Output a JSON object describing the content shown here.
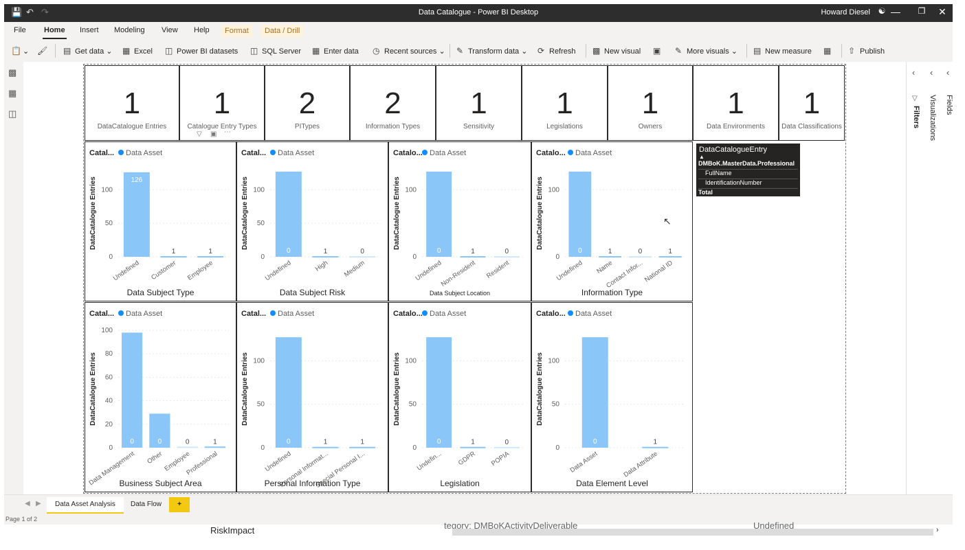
{
  "window": {
    "title": "Data Catalogue - Power BI Desktop",
    "user": "Howard Diesel"
  },
  "menu": [
    "File",
    "Home",
    "Insert",
    "Modeling",
    "View",
    "Help",
    "Format",
    "Data / Drill"
  ],
  "ribbon": {
    "get_data": "Get data",
    "excel": "Excel",
    "pbi_datasets": "Power BI datasets",
    "sql_server": "SQL Server",
    "enter_data": "Enter data",
    "recent_sources": "Recent sources",
    "transform_data": "Transform data",
    "refresh": "Refresh",
    "new_visual": "New visual",
    "more_visuals": "More visuals",
    "new_measure": "New measure",
    "publish": "Publish"
  },
  "panes": {
    "filters": "Filters",
    "visualizations": "Visualizations",
    "fields": "Fields"
  },
  "cards": [
    {
      "value": "1",
      "label": "DataCatalogue Entries"
    },
    {
      "value": "1",
      "label": "Catalogue Entry Types"
    },
    {
      "value": "2",
      "label": "PITypes"
    },
    {
      "value": "2",
      "label": "Information Types"
    },
    {
      "value": "1",
      "label": "Sensitivity"
    },
    {
      "value": "1",
      "label": "Legislations"
    },
    {
      "value": "1",
      "label": "Owners"
    },
    {
      "value": "1",
      "label": "Data Environments"
    },
    {
      "value": "1",
      "label": "Data Classifications"
    }
  ],
  "chart_common": {
    "ylabel": "DataCatalogue Entries",
    "legend": "Data Asset",
    "bar_color": "#8ac6f8",
    "accent": "#118dff"
  },
  "chart_data": [
    {
      "type": "bar",
      "title": "Catal...",
      "xlabel": "Data Subject Type",
      "categories": [
        "Undefined",
        "Customer",
        "Employee"
      ],
      "values": [
        126,
        1,
        1
      ],
      "labels": [
        "126",
        "1",
        "1"
      ],
      "ylim": [
        0,
        130
      ],
      "yticks": [
        0,
        50,
        100
      ]
    },
    {
      "type": "bar",
      "title": "Catal...",
      "xlabel": "Data Subject Risk",
      "categories": [
        "Undefined",
        "High",
        "Medium"
      ],
      "values": [
        127,
        1,
        0
      ],
      "labels": [
        "0",
        "1",
        "0"
      ],
      "ylim": [
        0,
        130
      ],
      "yticks": [
        0,
        50,
        100
      ]
    },
    {
      "type": "bar",
      "title": "Catalo...",
      "xlabel": "Data Subject Location",
      "categories": [
        "Undefined",
        "Non-Resident",
        "Resident"
      ],
      "values": [
        127,
        1,
        0
      ],
      "labels": [
        "0",
        "1",
        "0"
      ],
      "ylim": [
        0,
        130
      ],
      "yticks": [
        0,
        100
      ]
    },
    {
      "type": "bar",
      "title": "Catalo...",
      "xlabel": "Information Type",
      "categories": [
        "Undefined",
        "Name",
        "Contact Infor...",
        "National ID"
      ],
      "values": [
        127,
        1,
        0,
        1
      ],
      "labels": [
        "0",
        "1",
        "0",
        "1"
      ],
      "ylim": [
        0,
        130
      ],
      "yticks": [
        0,
        100
      ]
    },
    {
      "type": "bar",
      "title": "Catal...",
      "xlabel": "Business Subject Area",
      "categories": [
        "Data Management",
        "Other",
        "Employee",
        "Professional"
      ],
      "values": [
        98,
        29,
        0,
        1
      ],
      "labels": [
        "0",
        "0",
        "0",
        "1"
      ],
      "ylim": [
        0,
        100
      ],
      "yticks": [
        0,
        20,
        40,
        60,
        80,
        100
      ]
    },
    {
      "type": "bar",
      "title": "Catal...",
      "xlabel": "Personal Information Type",
      "categories": [
        "Undefined",
        "Personal Informat...",
        "Special Personal I..."
      ],
      "values": [
        127,
        1,
        1
      ],
      "labels": [
        "0",
        "1",
        "1"
      ],
      "ylim": [
        0,
        135
      ],
      "yticks": [
        0,
        50,
        100
      ]
    },
    {
      "type": "bar",
      "title": "Catalo...",
      "xlabel": "Legislation",
      "categories": [
        "Undefin...",
        "GDPR",
        "POPIA"
      ],
      "values": [
        127,
        1,
        0
      ],
      "labels": [
        "0",
        "1",
        "0"
      ],
      "ylim": [
        0,
        135
      ],
      "yticks": [
        0,
        50,
        100
      ]
    },
    {
      "type": "bar",
      "title": "Catalo...",
      "xlabel": "Data Element Level",
      "categories": [
        "Data Asset",
        "Data Attribute"
      ],
      "values": [
        127,
        1
      ],
      "labels": [
        "0",
        "1"
      ],
      "ylim": [
        0,
        135
      ],
      "yticks": [
        0,
        50,
        100
      ]
    }
  ],
  "matrix": {
    "header": "DataCatalogueEntry",
    "rows": [
      "DMBoK.MasterData.Professional",
      "FullName",
      "IdentificationNumber",
      "Total"
    ]
  },
  "tabs": {
    "tab1": "Data Asset Analysis",
    "tab2": "Data Flow",
    "add": "+"
  },
  "status": {
    "page": "Page 1 of 2"
  },
  "bottom": {
    "left": "RiskImpact",
    "middle": "tegory: DMBoKActivityDeliverable",
    "right": "Undefined"
  }
}
